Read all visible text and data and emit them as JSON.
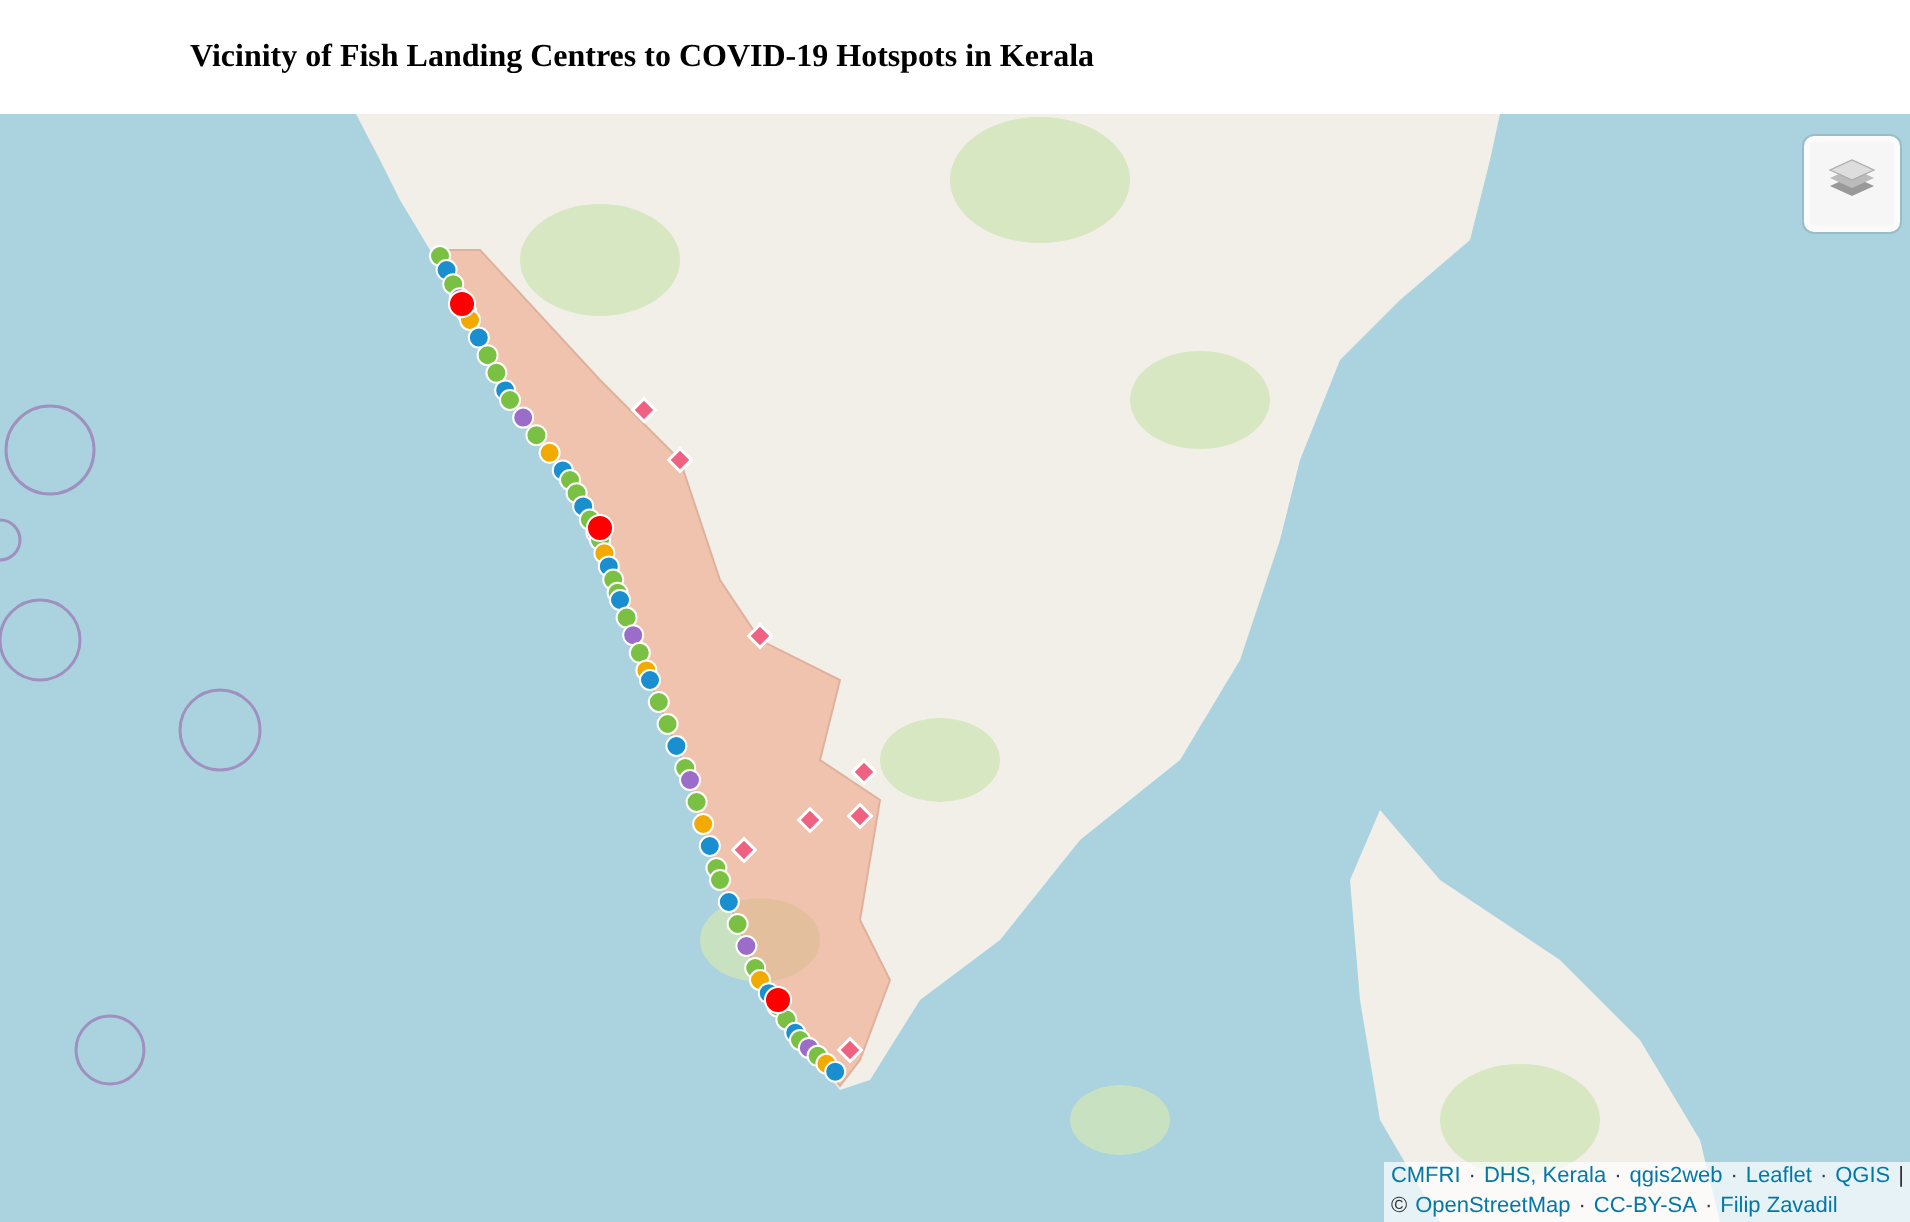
{
  "page": {
    "title": "Vicinity of Fish Landing Centres to COVID-19 Hotspots in Kerala"
  },
  "map": {
    "layers_control": {
      "expanded": false
    },
    "attribution": {
      "separator": "·",
      "lines": [
        {
          "items": [
            "CMFRI",
            "DHS, Kerala",
            "qgis2web",
            "Leaflet",
            "QGIS"
          ],
          "suffix": "|"
        },
        {
          "prefix": "©",
          "items": [
            "OpenStreetMap",
            "CC-BY-SA",
            "Filip Zavadil"
          ]
        }
      ]
    }
  }
}
